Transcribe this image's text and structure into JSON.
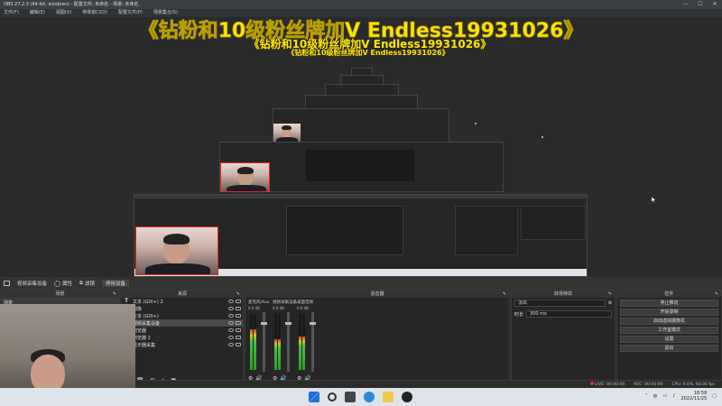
{
  "window": {
    "title": "OBS 27.2.3 (64-bit, windows) - 配置文件: 未命名 - 场景: 未命名",
    "controls": [
      "—",
      "☐",
      "✕"
    ]
  },
  "menu": [
    "文件(F)",
    "编辑(E)",
    "视图(V)",
    "停靠窗口(D)",
    "配置文件(P)",
    "场景集合(S)"
  ],
  "overlay": {
    "line1": "《钻粉和10级粉丝牌加V Endless19931026》",
    "line2": "《钻粉和10级粉丝牌加V Endless19931026》",
    "line3": "《钻粉和10级粉丝牌加V Endless19931026》"
  },
  "source_toolbar": {
    "selected_source": "视频采集设备",
    "properties": "属性",
    "filters": "滤镜",
    "deactivate": "停用设备"
  },
  "scenes": {
    "title": "场景",
    "items": [
      "场景"
    ]
  },
  "sources": {
    "title": "来源",
    "items": [
      {
        "icon": "T",
        "label": "文本 (GDI+) 2"
      },
      {
        "icon": "▪",
        "label": "图像"
      },
      {
        "icon": "T",
        "label": "文本 (GDI+)"
      },
      {
        "icon": "▣",
        "label": "视频采集设备"
      },
      {
        "icon": "▪",
        "label": "浏览器"
      },
      {
        "icon": "▪",
        "label": "浏览器 2"
      },
      {
        "icon": "▪",
        "label": "显示器采集"
      }
    ],
    "footer": [
      "+",
      "🗑",
      "⚙",
      "▲",
      "▼"
    ]
  },
  "mixer": {
    "title": "混音器",
    "channels": [
      {
        "name": "麦克风/Aux",
        "db": "0.0 dB",
        "level": 0.72,
        "fader": 0.82
      },
      {
        "name": "视频采集设备",
        "db": "0.0 dB",
        "level": 0.55,
        "fader": 0.82
      },
      {
        "name": "桌面音频",
        "db": "0.0 dB",
        "level": 0.6,
        "fader": 0.82
      }
    ]
  },
  "transitions": {
    "title": "转场特效",
    "selected": "淡出",
    "duration_label": "时长",
    "duration": "300 ms"
  },
  "controls": {
    "title": "控件",
    "buttons": [
      "停止推流",
      "开始录制",
      "启动虚拟摄像机",
      "工作室模式",
      "设置",
      "退出"
    ]
  },
  "status": {
    "live": "LIVE: 00:00:00",
    "rec": "REC: 00:00:00",
    "cpu": "CPU: 0.4%, 60.00 fps"
  },
  "taskbar": {
    "time": "18:58",
    "date": "2022/11/25",
    "lang": "中"
  },
  "colors": {
    "overlay_text": "#ffe600",
    "selected_border": "#ff2020",
    "taskbar": "#dfe3ea"
  }
}
